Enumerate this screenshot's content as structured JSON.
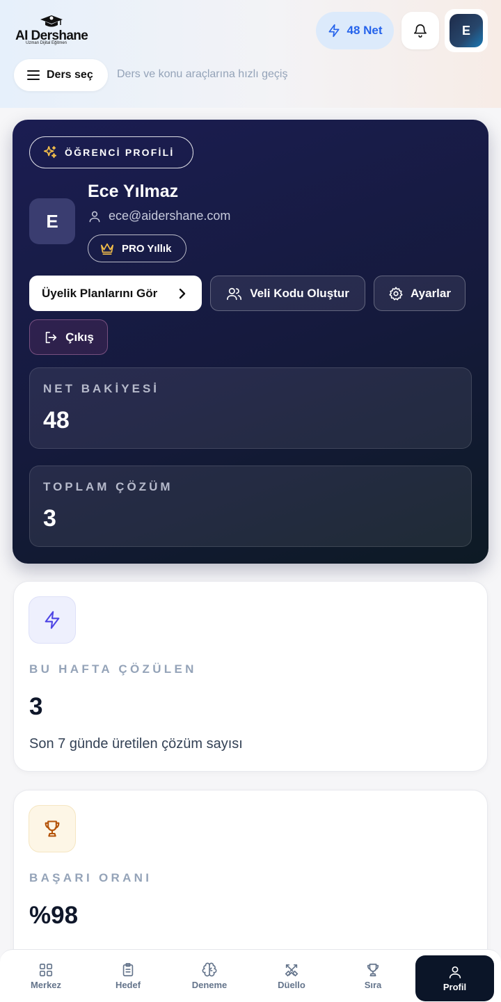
{
  "header": {
    "logo_title": "AI Dershane",
    "logo_subtitle": "Uzman Dijital Eğitmen",
    "net_label": "48 Net",
    "avatar_initial": "E",
    "ders_button_label": "Ders seç",
    "ders_hint": "Ders ve konu araçlarına hızlı geçiş"
  },
  "profile": {
    "badge": "ÖĞRENCİ PROFİLİ",
    "initial": "E",
    "name": "Ece Yılmaz",
    "email": "ece@aidershane.com",
    "plan": "PRO Yıllık",
    "btn_plans": "Üyelik Planlarını Gör",
    "btn_veli": "Veli Kodu Oluştur",
    "btn_settings": "Ayarlar",
    "btn_logout": "Çıkış",
    "stats": [
      {
        "label": "NET BAKİYESİ",
        "value": "48"
      },
      {
        "label": "TOPLAM ÇÖZÜM",
        "value": "3"
      }
    ]
  },
  "cards": [
    {
      "label": "BU HAFTA ÇÖZÜLEN",
      "value": "3",
      "desc": "Son 7 günde üretilen çözüm sayısı",
      "icon": "bolt-icon"
    },
    {
      "label": "BAŞARI ORANI",
      "value": "%98",
      "desc": "",
      "icon": "trophy-icon"
    }
  ],
  "nav": [
    {
      "label": "Merkez",
      "icon": "grid-icon"
    },
    {
      "label": "Hedef",
      "icon": "clipboard-icon"
    },
    {
      "label": "Deneme",
      "icon": "brain-icon"
    },
    {
      "label": "Düello",
      "icon": "swords-icon"
    },
    {
      "label": "Sıra",
      "icon": "trophy-icon"
    },
    {
      "label": "Profil",
      "icon": "user-icon",
      "active": true
    }
  ],
  "colors": {
    "accent": "#2563eb",
    "card_dark": "#1b1d52",
    "gold": "#f5c04a",
    "violet": "#4f46e5",
    "amber": "#b45309"
  }
}
